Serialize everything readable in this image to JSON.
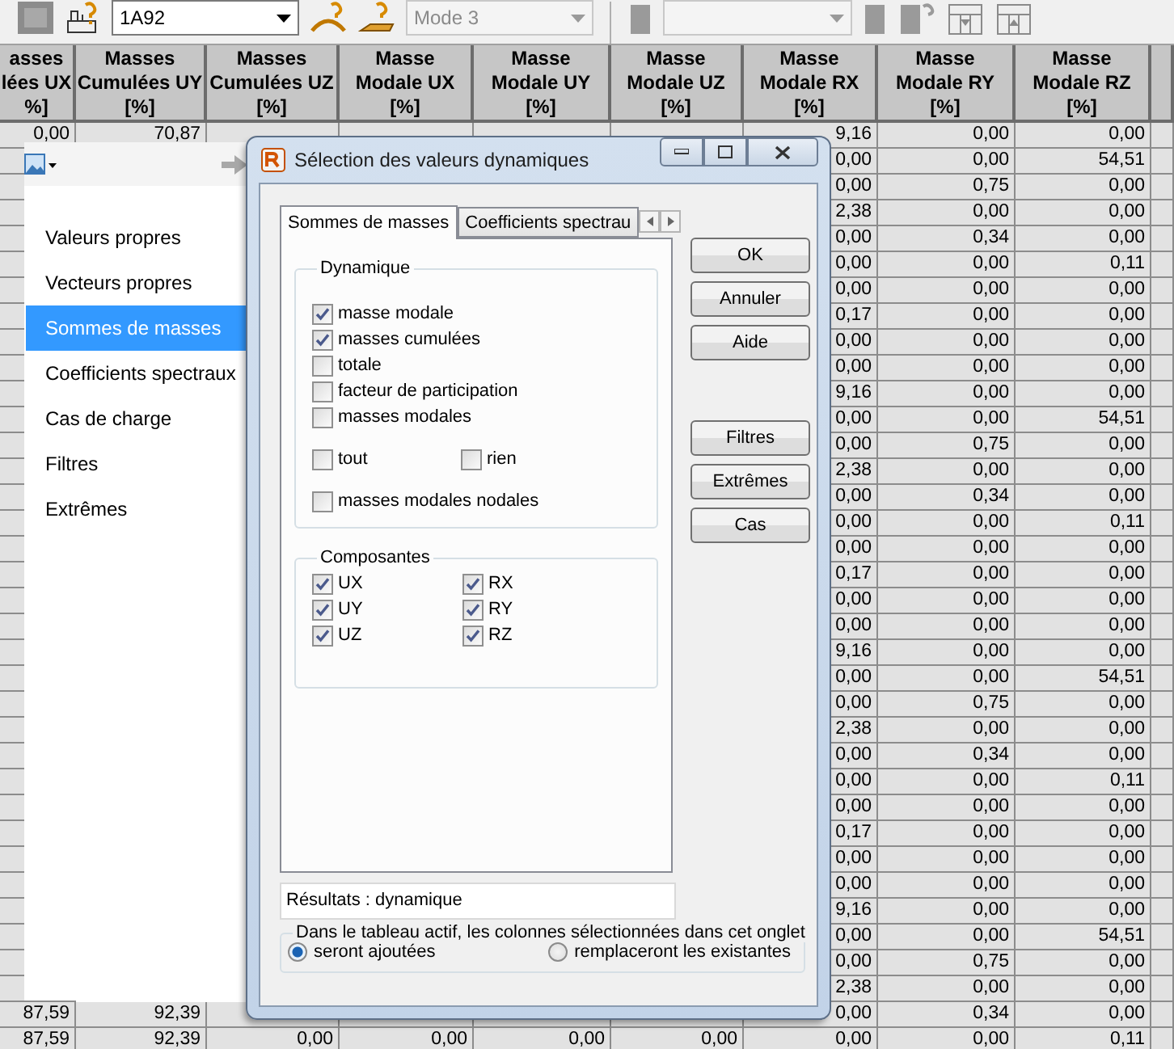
{
  "toolbar": {
    "case_combo": {
      "value": "1A92",
      "disabled": false
    },
    "mode_combo": {
      "value": "Mode  3",
      "disabled": true
    },
    "view_combo": {
      "disabled": true
    }
  },
  "table": {
    "columns": [
      {
        "label": "asses\nlées UX\n%]"
      },
      {
        "label": "Masses\nCumulées UY\n[%]"
      },
      {
        "label": "Masses\nCumulées UZ\n[%]"
      },
      {
        "label": "Masse\nModale UX\n[%]"
      },
      {
        "label": "Masse\nModale UY\n[%]"
      },
      {
        "label": "Masse\nModale UZ\n[%]"
      },
      {
        "label": "Masse\nModale RX\n[%]"
      },
      {
        "label": "Masse\nModale RY\n[%]"
      },
      {
        "label": "Masse\nModale RZ\n[%]"
      }
    ],
    "rows": [
      {
        "cells": [
          "0,00",
          "70,87",
          null,
          null,
          null,
          null,
          "9,16",
          "0,00",
          "0,00"
        ]
      },
      {
        "cells": [
          null,
          null,
          null,
          null,
          null,
          null,
          "0,00",
          "0,00",
          "54,51"
        ]
      },
      {
        "cells": [
          null,
          null,
          null,
          null,
          null,
          null,
          "0,00",
          "0,75",
          "0,00"
        ]
      },
      {
        "cells": [
          null,
          null,
          null,
          null,
          null,
          null,
          "2,38",
          "0,00",
          "0,00"
        ]
      },
      {
        "cells": [
          null,
          null,
          null,
          null,
          null,
          null,
          "0,00",
          "0,34",
          "0,00"
        ]
      },
      {
        "cells": [
          null,
          null,
          null,
          null,
          null,
          null,
          "0,00",
          "0,00",
          "0,11"
        ]
      },
      {
        "cells": [
          null,
          null,
          null,
          null,
          null,
          null,
          "0,00",
          "0,00",
          "0,00"
        ]
      },
      {
        "cells": [
          null,
          null,
          null,
          null,
          null,
          null,
          "0,17",
          "0,00",
          "0,00"
        ]
      },
      {
        "cells": [
          null,
          null,
          null,
          null,
          null,
          null,
          "0,00",
          "0,00",
          "0,00"
        ]
      },
      {
        "cells": [
          null,
          null,
          null,
          null,
          null,
          null,
          "0,00",
          "0,00",
          "0,00"
        ]
      },
      {
        "cells": [
          null,
          null,
          null,
          null,
          null,
          null,
          "9,16",
          "0,00",
          "0,00"
        ]
      },
      {
        "cells": [
          null,
          null,
          null,
          null,
          null,
          null,
          "0,00",
          "0,00",
          "54,51"
        ]
      },
      {
        "cells": [
          null,
          null,
          null,
          null,
          null,
          null,
          "0,00",
          "0,75",
          "0,00"
        ]
      },
      {
        "cells": [
          null,
          null,
          null,
          null,
          null,
          null,
          "2,38",
          "0,00",
          "0,00"
        ]
      },
      {
        "cells": [
          null,
          null,
          null,
          null,
          null,
          null,
          "0,00",
          "0,34",
          "0,00"
        ]
      },
      {
        "cells": [
          null,
          null,
          null,
          null,
          null,
          null,
          "0,00",
          "0,00",
          "0,11"
        ]
      },
      {
        "cells": [
          null,
          null,
          null,
          null,
          null,
          null,
          "0,00",
          "0,00",
          "0,00"
        ]
      },
      {
        "cells": [
          null,
          null,
          null,
          null,
          null,
          null,
          "0,17",
          "0,00",
          "0,00"
        ]
      },
      {
        "cells": [
          null,
          null,
          null,
          null,
          null,
          null,
          "0,00",
          "0,00",
          "0,00"
        ]
      },
      {
        "cells": [
          null,
          null,
          null,
          null,
          null,
          null,
          "0,00",
          "0,00",
          "0,00"
        ]
      },
      {
        "cells": [
          null,
          null,
          null,
          null,
          null,
          null,
          "9,16",
          "0,00",
          "0,00"
        ]
      },
      {
        "cells": [
          null,
          null,
          null,
          null,
          null,
          null,
          "0,00",
          "0,00",
          "54,51"
        ]
      },
      {
        "cells": [
          null,
          null,
          null,
          null,
          null,
          null,
          "0,00",
          "0,75",
          "0,00"
        ]
      },
      {
        "cells": [
          null,
          null,
          null,
          null,
          null,
          null,
          "2,38",
          "0,00",
          "0,00"
        ]
      },
      {
        "cells": [
          null,
          null,
          null,
          null,
          null,
          null,
          "0,00",
          "0,34",
          "0,00"
        ]
      },
      {
        "cells": [
          null,
          null,
          null,
          null,
          null,
          null,
          "0,00",
          "0,00",
          "0,11"
        ]
      },
      {
        "cells": [
          null,
          null,
          null,
          null,
          null,
          null,
          "0,00",
          "0,00",
          "0,00"
        ]
      },
      {
        "cells": [
          null,
          null,
          null,
          null,
          null,
          null,
          "0,17",
          "0,00",
          "0,00"
        ]
      },
      {
        "cells": [
          null,
          null,
          null,
          null,
          null,
          null,
          "0,00",
          "0,00",
          "0,00"
        ]
      },
      {
        "cells": [
          null,
          null,
          null,
          null,
          null,
          null,
          "0,00",
          "0,00",
          "0,00"
        ]
      },
      {
        "cells": [
          null,
          null,
          null,
          null,
          null,
          null,
          "9,16",
          "0,00",
          "0,00"
        ]
      },
      {
        "cells": [
          null,
          null,
          null,
          null,
          null,
          null,
          "0,00",
          "0,00",
          "54,51"
        ]
      },
      {
        "cells": [
          null,
          null,
          null,
          null,
          null,
          null,
          "0,00",
          "0,75",
          "0,00"
        ]
      },
      {
        "cells": [
          null,
          null,
          null,
          null,
          null,
          null,
          "2,38",
          "0,00",
          "0,00"
        ]
      },
      {
        "cells": [
          "87,59",
          "92,39",
          null,
          null,
          null,
          null,
          "0,00",
          "0,34",
          "0,00"
        ]
      },
      {
        "cells": [
          "87,59",
          "92,39",
          "0,00",
          "0,00",
          "0,00",
          "0,00",
          "0,00",
          "0,00",
          "0,11"
        ]
      }
    ]
  },
  "side_panel": {
    "items": [
      {
        "label": "Valeurs propres",
        "selected": false
      },
      {
        "label": "Vecteurs propres",
        "selected": false
      },
      {
        "label": "Sommes de masses",
        "selected": true
      },
      {
        "label": "Coefficients spectraux",
        "selected": false
      },
      {
        "label": "Cas de charge",
        "selected": false
      },
      {
        "label": "Filtres",
        "selected": false
      },
      {
        "label": "Extrêmes",
        "selected": false
      }
    ]
  },
  "dialog": {
    "title": "Sélection des valeurs dynamiques",
    "tabs": [
      {
        "label": "Sommes de masses",
        "selected": true
      },
      {
        "label": "Coefficients spectrau",
        "selected": false
      }
    ],
    "dynamique": {
      "title": "Dynamique",
      "options": [
        {
          "label": "masse modale",
          "checked": true
        },
        {
          "label": "masses cumulées",
          "checked": true
        },
        {
          "label": "totale",
          "checked": false
        },
        {
          "label": "facteur de participation",
          "checked": false
        },
        {
          "label": "masses modales",
          "checked": false
        }
      ],
      "toggles": [
        {
          "label": "tout",
          "checked": false
        },
        {
          "label": "rien",
          "checked": false
        }
      ],
      "nodal": {
        "label": "masses modales nodales",
        "checked": false
      }
    },
    "composantes": {
      "title": "Composantes",
      "options": [
        {
          "label": "UX",
          "checked": true
        },
        {
          "label": "UY",
          "checked": true
        },
        {
          "label": "UZ",
          "checked": true
        },
        {
          "label": "RX",
          "checked": true
        },
        {
          "label": "RY",
          "checked": true
        },
        {
          "label": "RZ",
          "checked": true
        }
      ]
    },
    "buttons": [
      {
        "label": "OK"
      },
      {
        "label": "Annuler"
      },
      {
        "label": "Aide"
      }
    ],
    "tool_buttons": [
      {
        "label": "Filtres"
      },
      {
        "label": "Extrêmes"
      },
      {
        "label": "Cas"
      }
    ],
    "results_field": {
      "value": "Résultats : dynamique"
    },
    "insert_mode": {
      "title": "Dans le tableau actif, les colonnes sélectionnées dans cet onglet",
      "options": [
        {
          "label": "seront ajoutées",
          "selected": true
        },
        {
          "label": "remplaceront les existantes",
          "selected": false
        }
      ]
    }
  }
}
